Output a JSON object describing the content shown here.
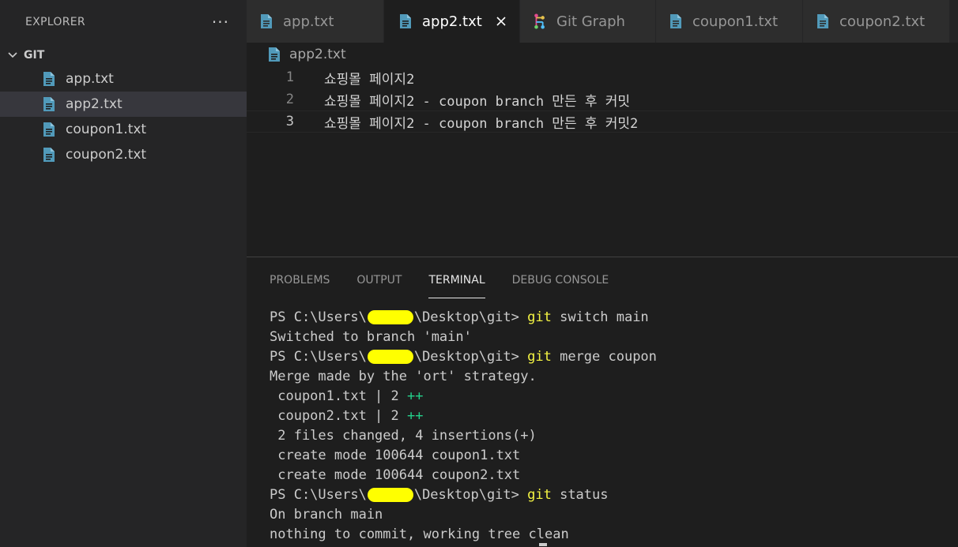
{
  "sidebar": {
    "title": "EXPLORER",
    "more": "···",
    "section": "GIT",
    "files": [
      {
        "name": "app.txt"
      },
      {
        "name": "app2.txt",
        "selected": true
      },
      {
        "name": "coupon1.txt"
      },
      {
        "name": "coupon2.txt"
      }
    ]
  },
  "tabs": [
    {
      "label": "app.txt",
      "icon": "file-icon"
    },
    {
      "label": "app2.txt",
      "icon": "file-icon",
      "active": true
    },
    {
      "label": "Git Graph",
      "icon": "git-graph-icon"
    },
    {
      "label": "coupon1.txt",
      "icon": "file-icon"
    },
    {
      "label": "coupon2.txt",
      "icon": "file-icon"
    }
  ],
  "breadcrumb": "app2.txt",
  "editor": {
    "lines": [
      {
        "num": "1",
        "text": "쇼핑몰 페이지2"
      },
      {
        "num": "2",
        "text": "쇼핑몰 페이지2 - coupon branch 만든 후 커밋"
      },
      {
        "num": "3",
        "text": "쇼핑몰 페이지2 - coupon branch 만든 후 커밋2"
      }
    ]
  },
  "panel": {
    "tabs": [
      "PROBLEMS",
      "OUTPUT",
      "TERMINAL",
      "DEBUG CONSOLE"
    ],
    "active_tab": "TERMINAL"
  },
  "terminal": {
    "prompt_pre": "PS C:\\Users\\",
    "prompt_post": "\\Desktop\\git> ",
    "cmd1_git": "git",
    "cmd1_rest": " switch main",
    "out1": "Switched to branch 'main'",
    "cmd2_git": "git",
    "cmd2_rest": " merge coupon",
    "out2": "Merge made by the 'ort' strategy.",
    "stat1_text": " coupon1.txt | 2 ",
    "stat1_plus": "++",
    "stat2_text": " coupon2.txt | 2 ",
    "stat2_plus": "++",
    "summary": " 2 files changed, 4 insertions(+)",
    "create1": " create mode 100644 coupon1.txt",
    "create2": " create mode 100644 coupon2.txt",
    "cmd3_git": "git",
    "cmd3_rest": " status",
    "out3": "On branch main",
    "out4_pre": "nothing to commit, working tree",
    "out4_post": "clean"
  },
  "colors": {
    "accent": "#ffffff",
    "file_icon": "#519aba",
    "command": "#f5f543",
    "diff_add": "#23d18b",
    "redaction": "#ffff00"
  }
}
